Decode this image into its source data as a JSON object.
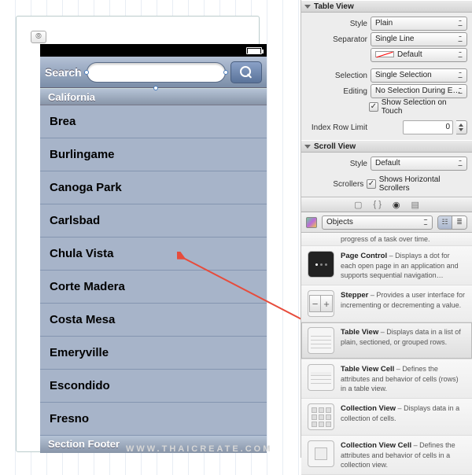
{
  "phone": {
    "search_label": "Search",
    "search_placeholder": "",
    "section_header": "California",
    "rows": [
      "Brea",
      "Burlingame",
      "Canoga Park",
      "Carlsbad",
      "Chula Vista",
      "Corte Madera",
      "Costa Mesa",
      "Emeryville",
      "Escondido",
      "Fresno"
    ],
    "section_footer": "Section Footer"
  },
  "inspector": {
    "table_view": {
      "title": "Table View",
      "style_label": "Style",
      "style_value": "Plain",
      "separator_label": "Separator",
      "separator_value": "Single Line",
      "separator_color": "Default",
      "selection_label": "Selection",
      "selection_value": "Single Selection",
      "editing_label": "Editing",
      "editing_value": "No Selection During E…",
      "show_selection": "Show Selection on Touch",
      "index_row_limit_label": "Index Row Limit",
      "index_row_limit_value": "0"
    },
    "scroll_view": {
      "title": "Scroll View",
      "style_label": "Style",
      "style_value": "Default",
      "scrollers_label": "Scrollers",
      "scrollers_value": "Shows Horizontal Scrollers"
    }
  },
  "library": {
    "picker_label": "Objects",
    "truncated": "progress of a task over time.",
    "items": [
      {
        "name": "Page Control",
        "desc": "Displays a dot for each open page in an application and supports sequential navigation…"
      },
      {
        "name": "Stepper",
        "desc": "Provides a user interface for incrementing or decrementing a value."
      },
      {
        "name": "Table View",
        "desc": "Displays data in a list of plain, sectioned, or grouped rows."
      },
      {
        "name": "Table View Cell",
        "desc": "Defines the attributes and behavior of cells (rows) in a table view."
      },
      {
        "name": "Collection View",
        "desc": "Displays data in a collection of cells."
      },
      {
        "name": "Collection View Cell",
        "desc": "Defines the attributes and behavior of cells in a collection view."
      }
    ]
  },
  "watermark": "WWW.THAICREATE.COM"
}
